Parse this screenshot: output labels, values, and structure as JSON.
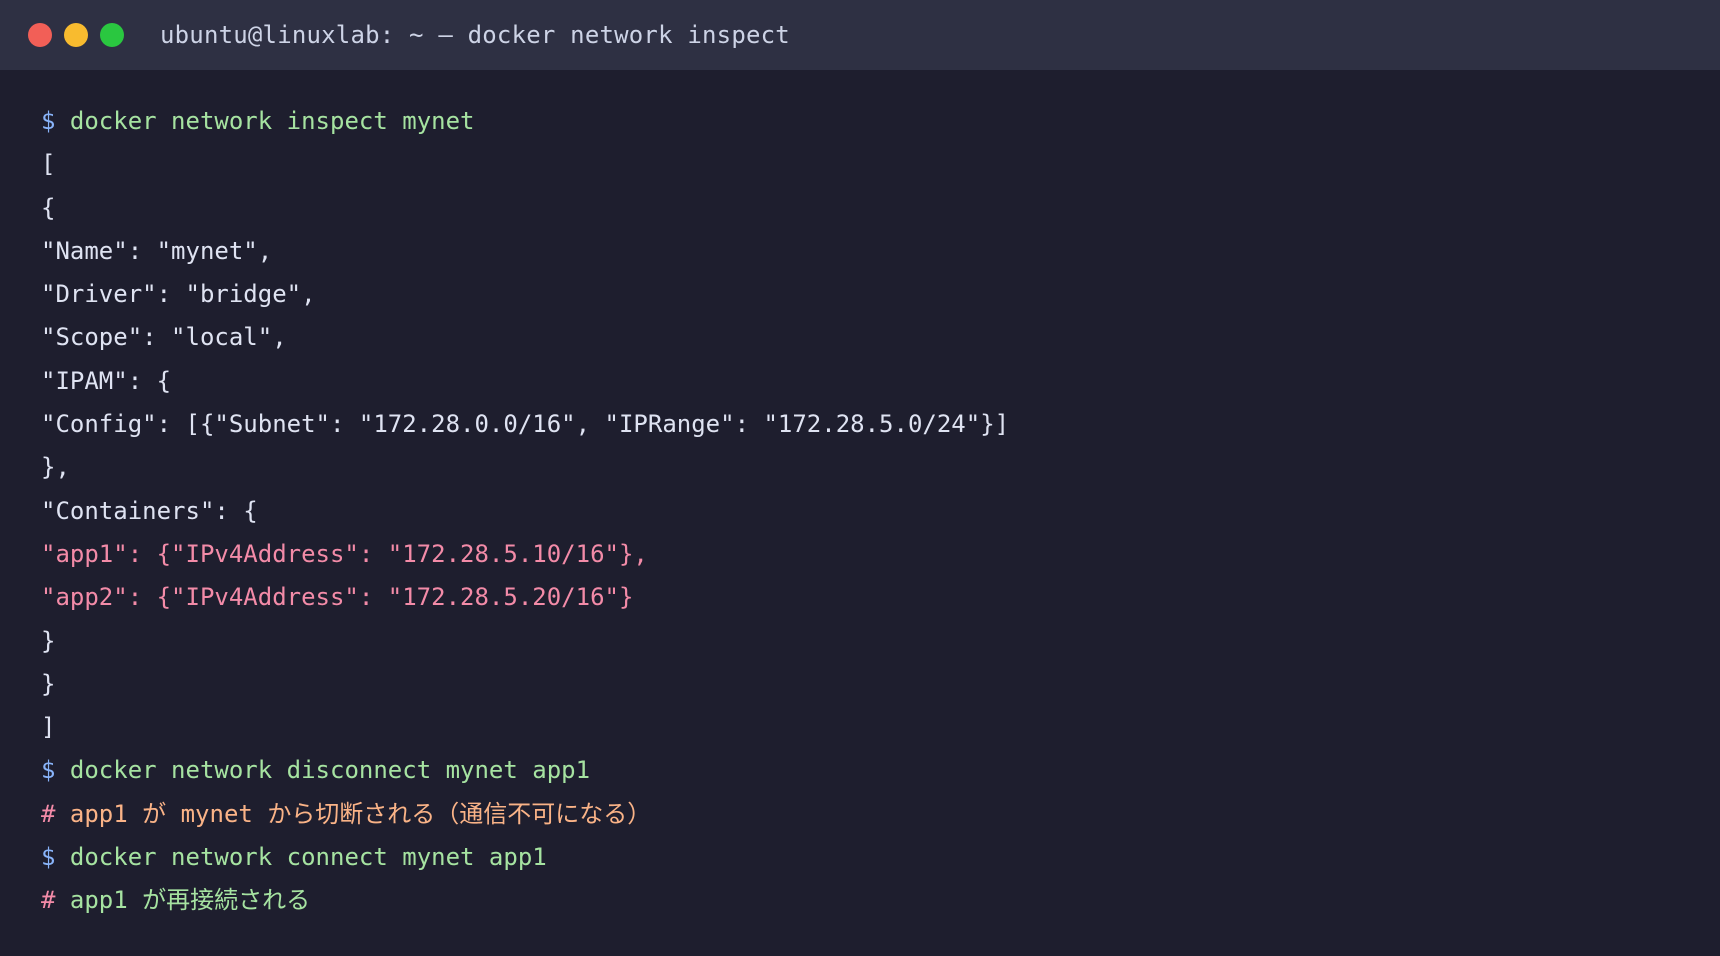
{
  "window": {
    "title": "ubuntu@linuxlab: ~ — docker network inspect"
  },
  "colors": {
    "background": "#1e1e2e",
    "titlebar": "#2e3043",
    "prompt": "#89b4fa",
    "command": "#a6e3a1",
    "output": "#dfe3f2",
    "highlight": "#f38ba8",
    "comment_orange": "#fab387"
  },
  "terminal": {
    "prompt_symbol": "$",
    "comment_symbol": "#",
    "cmd1": "docker network inspect mynet",
    "out": [
      "[",
      "{",
      "\"Name\": \"mynet\",",
      "\"Driver\": \"bridge\",",
      "\"Scope\": \"local\",",
      "\"IPAM\": {",
      "\"Config\": [{\"Subnet\": \"172.28.0.0/16\", \"IPRange\": \"172.28.5.0/24\"}]",
      "},",
      "\"Containers\": {"
    ],
    "highlight": [
      "\"app1\": {\"IPv4Address\": \"172.28.5.10/16\"},",
      "\"app2\": {\"IPv4Address\": \"172.28.5.20/16\"}"
    ],
    "out_end": [
      "}",
      "}",
      "]"
    ],
    "cmd2": "docker network disconnect mynet app1",
    "comment1": {
      "a": "app1",
      "b": "が",
      "c": "mynet",
      "d": "から切断される（通信不可になる）"
    },
    "cmd3": "docker network connect mynet app1",
    "comment2": {
      "a": "app1",
      "b": "が再接続される"
    }
  }
}
